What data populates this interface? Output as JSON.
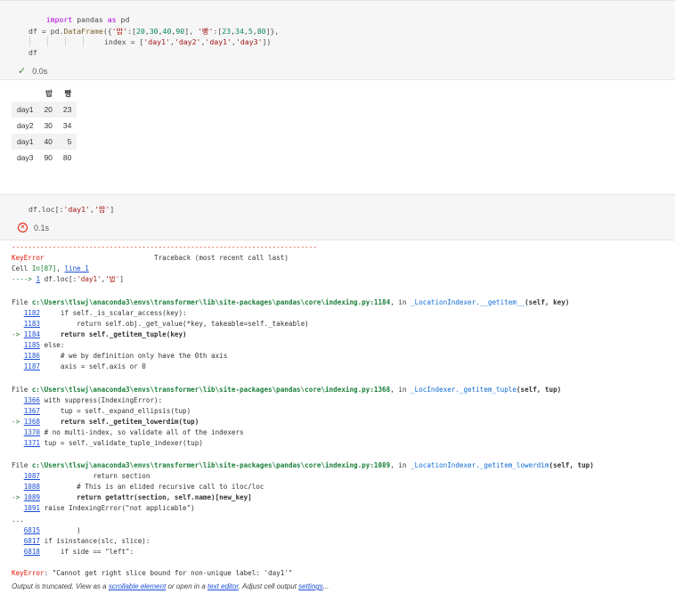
{
  "cell1": {
    "code_lines": [
      "import pandas as pd",
      "",
      "df = pd.DataFrame({'밥':[20,30,40,90], '빵':[23,34,5,80]},",
      "                  index = ['day1','day2','day1','day3'])",
      "df"
    ],
    "status_time": "0.0s"
  },
  "dataframe": {
    "columns": [
      "밥",
      "빵"
    ],
    "rows": [
      {
        "index": "day1",
        "values": [
          "20",
          "23"
        ]
      },
      {
        "index": "day2",
        "values": [
          "30",
          "34"
        ]
      },
      {
        "index": "day1",
        "values": [
          "40",
          "5"
        ]
      },
      {
        "index": "day3",
        "values": [
          "90",
          "80"
        ]
      }
    ]
  },
  "cell2": {
    "code_lines": [
      "df.loc[:'day1','밥']"
    ],
    "status_time": "0.1s"
  },
  "traceback": {
    "separator": "---------------------------------------------------------------------------",
    "error_name": "KeyError",
    "traceback_label": "Traceback (most recent call last)",
    "cell_ref": "Cell In[87], line 1",
    "arrow_line": "----> 1 df.loc[:'day1','밥']",
    "frames": [
      {
        "file_line": "File c:\\Users\\tlswj\\anaconda3\\envs\\transformer\\lib\\site-packages\\pandas\\core\\indexing.py:1184, in _LocationIndexer.__getitem__(self, key)",
        "lines": [
          {
            "prefix": "   ",
            "num": "1182",
            "code": "    if self._is_scalar_access(key):"
          },
          {
            "prefix": "   ",
            "num": "1183",
            "code": "        return self.obj._get_value(*key, takeable=self._takeable)"
          },
          {
            "prefix": "-> ",
            "num": "1184",
            "code": "    return self._getitem_tuple(key)"
          },
          {
            "prefix": "   ",
            "num": "1185",
            "code": "else:"
          },
          {
            "prefix": "   ",
            "num": "1186",
            "code": "    # we by definition only have the 0th axis"
          },
          {
            "prefix": "   ",
            "num": "1187",
            "code": "    axis = self.axis or 0"
          }
        ]
      },
      {
        "file_line": "File c:\\Users\\tlswj\\anaconda3\\envs\\transformer\\lib\\site-packages\\pandas\\core\\indexing.py:1368, in _LocIndexer._getitem_tuple(self, tup)",
        "lines": [
          {
            "prefix": "   ",
            "num": "1366",
            "code": "with suppress(IndexingError):"
          },
          {
            "prefix": "   ",
            "num": "1367",
            "code": "    tup = self._expand_ellipsis(tup)"
          },
          {
            "prefix": "-> ",
            "num": "1368",
            "code": "    return self._getitem_lowerdim(tup)"
          },
          {
            "prefix": "   ",
            "num": "1370",
            "code": "# no multi-index, so validate all of the indexers"
          },
          {
            "prefix": "   ",
            "num": "1371",
            "code": "tup = self._validate_tuple_indexer(tup)"
          }
        ]
      },
      {
        "file_line": "File c:\\Users\\tlswj\\anaconda3\\envs\\transformer\\lib\\site-packages\\pandas\\core\\indexing.py:1089, in _LocationIndexer._getitem_lowerdim(self, tup)",
        "lines": [
          {
            "prefix": "   ",
            "num": "1087",
            "code": "            return section"
          },
          {
            "prefix": "   ",
            "num": "1088",
            "code": "        # This is an elided recursive call to iloc/loc"
          },
          {
            "prefix": "-> ",
            "num": "1089",
            "code": "        return getattr(section, self.name)[new_key]"
          },
          {
            "prefix": "   ",
            "num": "1091",
            "code": "raise IndexingError(\"not applicable\")"
          }
        ]
      }
    ],
    "ellipsis": "...",
    "tail_lines": [
      {
        "prefix": "   ",
        "num": "6815",
        "code": "        )"
      },
      {
        "prefix": "   ",
        "num": "6817",
        "code": "if isinstance(slc, slice):"
      },
      {
        "prefix": "   ",
        "num": "6818",
        "code": "    if side == \"left\":"
      }
    ],
    "final_error_name": "KeyError",
    "final_error_msg": ": \"Cannot get right slice bound for non-unique label: 'day1'\""
  },
  "footer": {
    "t1": "Output is truncated. View as a ",
    "link1": "scrollable element",
    "t2": " or open in a ",
    "link2": "text editor",
    "t3": ". Adjust cell output ",
    "link3": "settings",
    "t4": "..."
  }
}
